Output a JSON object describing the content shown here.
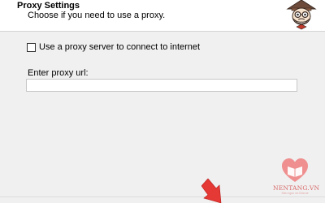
{
  "header": {
    "title": "Proxy Settings",
    "subtitle": "Choose if you need to use a proxy."
  },
  "proxy_checkbox": {
    "label": "Use a proxy server to connect to internet",
    "checked": false
  },
  "proxy_url": {
    "label": "Enter proxy url:",
    "value": ""
  },
  "watermark": {
    "brand": "NENTANG.VN",
    "tagline": "Sieu ngoc va Chia se"
  },
  "colors": {
    "header_bg": "#ffffff",
    "body_bg": "#f0f0f0",
    "watermark": "#d86a6a",
    "arrow": "#e53935"
  },
  "icons": {
    "logo": "cartoon-mascot-logo",
    "watermark_logo": "heart-book-logo",
    "pointer": "red-arrow-pointer"
  }
}
